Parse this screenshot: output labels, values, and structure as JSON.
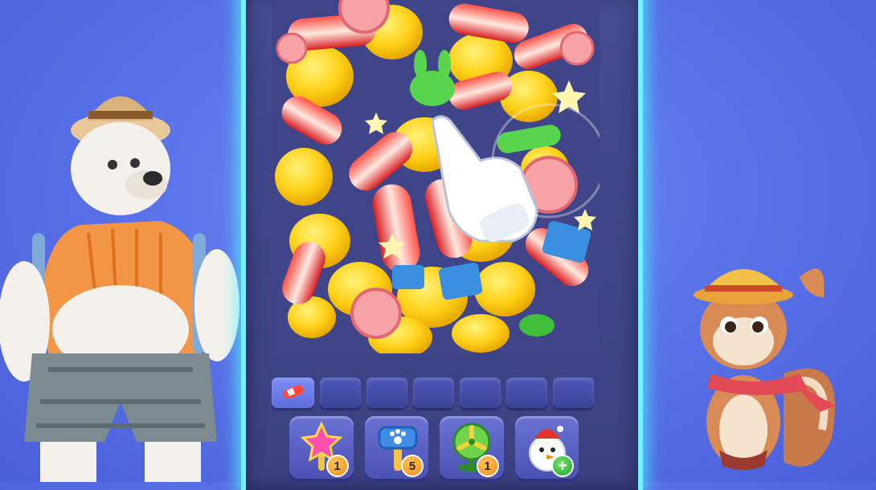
{
  "game": {
    "tray_slots": 7,
    "boosters": [
      {
        "id": "magic-wand",
        "icon": "star-wand-icon",
        "count": "1"
      },
      {
        "id": "hammer",
        "icon": "paw-hammer-icon",
        "count": "5"
      },
      {
        "id": "fan",
        "icon": "fan-icon",
        "count": "1"
      },
      {
        "id": "snowman",
        "icon": "snowman-icon",
        "count": "+"
      }
    ]
  },
  "colors": {
    "background": "#5b74ea",
    "board": "#3f4588",
    "neon_border": "#6df4ff",
    "duck": "#ffd21a",
    "badge_orange": "#f39a22",
    "badge_green": "#2fb33a"
  }
}
